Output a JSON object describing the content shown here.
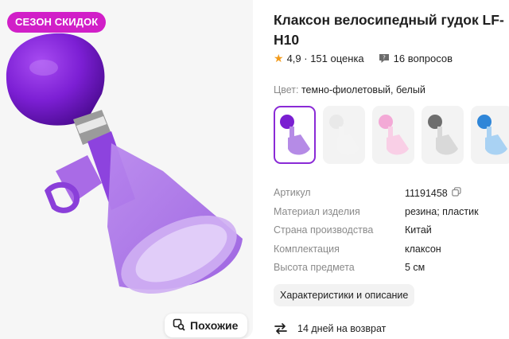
{
  "gallery": {
    "promo_badge": "СЕЗОН СКИДОК",
    "similar_button": "Похожие"
  },
  "product": {
    "title": "Клаксон велосипедный гудок LF-H10",
    "rating": "4,9",
    "reviews": "151 оценка",
    "questions": "16 вопросов",
    "color_label": "Цвет:",
    "color_value": "темно-фиолетовый, белый"
  },
  "swatches": [
    {
      "name": "фиолетовый",
      "bulb": "#7a1fd1",
      "horn": "#b58be6",
      "active": true
    },
    {
      "name": "белый",
      "bulb": "#e9e9e9",
      "horn": "#f4f4f4",
      "active": false
    },
    {
      "name": "розовый",
      "bulb": "#f3a9d6",
      "horn": "#f9cfe6",
      "active": false
    },
    {
      "name": "серый",
      "bulb": "#6e6e6e",
      "horn": "#d9d9d9",
      "active": false
    },
    {
      "name": "голубой",
      "bulb": "#2f86d8",
      "horn": "#a9d2f3",
      "active": false
    }
  ],
  "specs": [
    {
      "key": "Артикул",
      "value": "11191458",
      "copy": true
    },
    {
      "key": "Материал изделия",
      "value": "резина; пластик"
    },
    {
      "key": "Страна производства",
      "value": "Китай"
    },
    {
      "key": "Комплектация",
      "value": "клаксон"
    },
    {
      "key": "Высота предмета",
      "value": "5 см"
    }
  ],
  "description_button": "Характеристики и описание",
  "returns": "14 дней на возврат",
  "colors": {
    "promo": "#d11fc8",
    "accent": "#8a2ad6",
    "star": "#f29b1c"
  },
  "icons": [
    "search-similar-icon",
    "star-icon",
    "question-icon",
    "copy-icon",
    "return-arrows-icon"
  ]
}
